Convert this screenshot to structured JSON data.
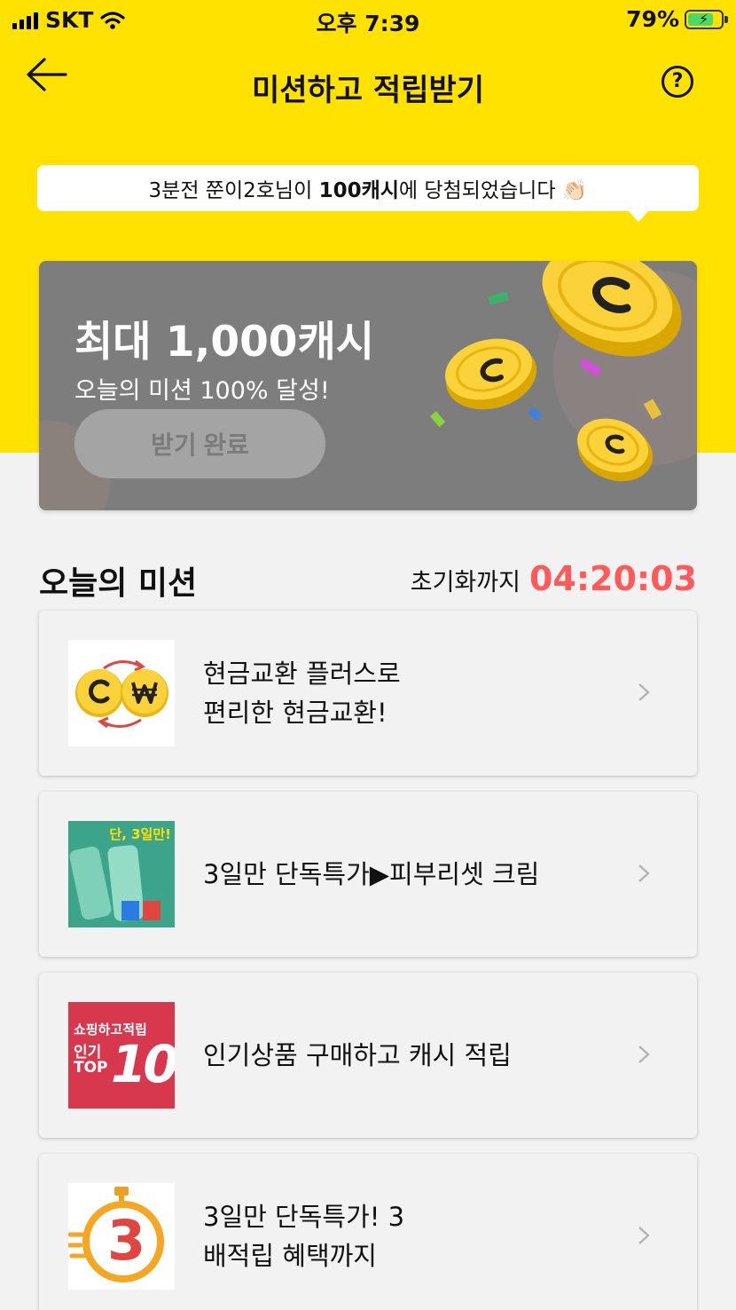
{
  "status_bar": {
    "carrier": "SKT",
    "time": "오후 7:39",
    "battery": "79%"
  },
  "header": {
    "title": "미션하고 적립받기"
  },
  "ticker": {
    "prefix": "3분전 쭌이2호님이 ",
    "highlight": "100캐시",
    "suffix": "에 당첨되었습니다 👏🏻"
  },
  "banner": {
    "headline": "최대 1,000캐시",
    "sub": "오늘의 미션 100% 달성!",
    "button": "받기 완료"
  },
  "missions_section": {
    "title": "오늘의 미션",
    "reset_label": "초기화까지",
    "countdown": "04:20:03"
  },
  "missions": [
    {
      "line1": "현금교환 플러스로",
      "line2": "편리한 현금교환!",
      "icon": "cash-exchange-icon"
    },
    {
      "line1": "3일만 단독특가▶피부리셋 크림",
      "line2": "",
      "icon": "product-cream-thumbnail",
      "thumb_text": "단, 3일만!"
    },
    {
      "line1": "인기상품 구매하고 캐시 적립",
      "line2": "",
      "icon": "top10-shopping-thumbnail",
      "thumb_line1": "쇼핑하고적립",
      "thumb_line2": "인기",
      "thumb_line3": "TOP",
      "thumb_num": "10"
    },
    {
      "line1": "3일만 단독특가! 3",
      "line2": "배적립 혜택까지",
      "icon": "stopwatch-3-icon",
      "thumb_num": "3"
    }
  ],
  "colors": {
    "accent_yellow": "#ffe200",
    "countdown_red": "#ff5a5a",
    "banner_gray": "#7d7d7d"
  }
}
